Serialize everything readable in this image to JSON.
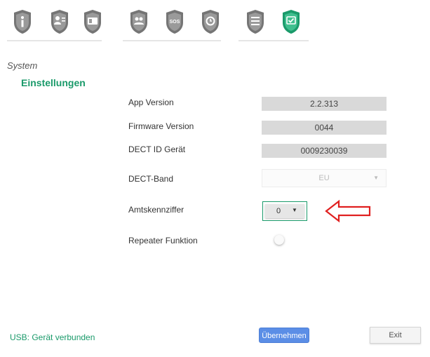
{
  "toolbar": {
    "icons": [
      {
        "name": "info-icon",
        "glyph": "i"
      },
      {
        "name": "user-card-icon",
        "glyph": "user"
      },
      {
        "name": "phone-card-icon",
        "glyph": "card"
      },
      {
        "name": "contacts-icon",
        "glyph": "people"
      },
      {
        "name": "sos-icon",
        "glyph": "SOS"
      },
      {
        "name": "alarm-clock-icon",
        "glyph": "clock"
      },
      {
        "name": "settings-list-icon",
        "glyph": "list"
      },
      {
        "name": "system-check-icon",
        "glyph": "check",
        "active": true
      }
    ],
    "icon_color": "#757575",
    "active_color": "#1a9a6a"
  },
  "section": "System",
  "subsection": "Einstellungen",
  "fields": {
    "app_version": {
      "label": "App Version",
      "value": "2.2.313"
    },
    "firmware_version": {
      "label": "Firmware Version",
      "value": "0044"
    },
    "dect_id": {
      "label": "DECT ID Gerät",
      "value": "0009230039"
    },
    "dect_band": {
      "label": "DECT-Band",
      "value": "EU"
    },
    "amtskennziffer": {
      "label": "Amtskennziffer",
      "value": "0"
    },
    "repeater": {
      "label": "Repeater Funktion",
      "enabled": false
    }
  },
  "status_text": "USB: Gerät verbunden",
  "buttons": {
    "apply": "Übernehmen",
    "exit": "Exit"
  },
  "annotation": {
    "color": "#e02020",
    "shape": "arrow-left"
  }
}
